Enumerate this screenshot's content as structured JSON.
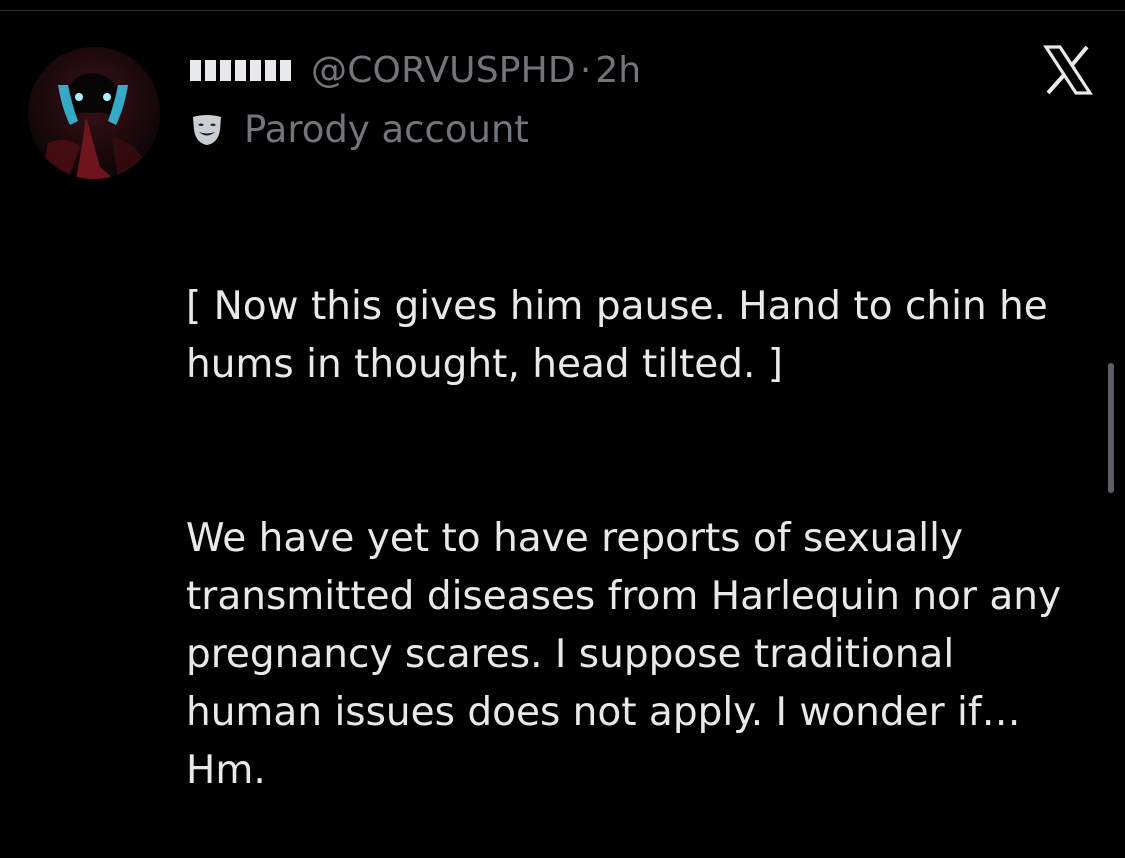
{
  "post": {
    "handle": "@CORVUSPHD",
    "separator": "·",
    "time": "2h",
    "label": "Parody account",
    "paragraphs": [
      "[ Now this gives him pause. Hand to chin he hums in thought, head tilted. ]",
      "We have yet to have reports of sexually transmitted diseases from Harlequin nor any pregnancy scares. I suppose traditional human issues does not apply. I wonder if… Hm."
    ]
  },
  "icons": {
    "label_icon": "theater-mask-icon",
    "logo": "x-logo-icon"
  },
  "colors": {
    "background": "#000000",
    "text": "#e7e9ea",
    "secondary_text": "#71767b"
  }
}
